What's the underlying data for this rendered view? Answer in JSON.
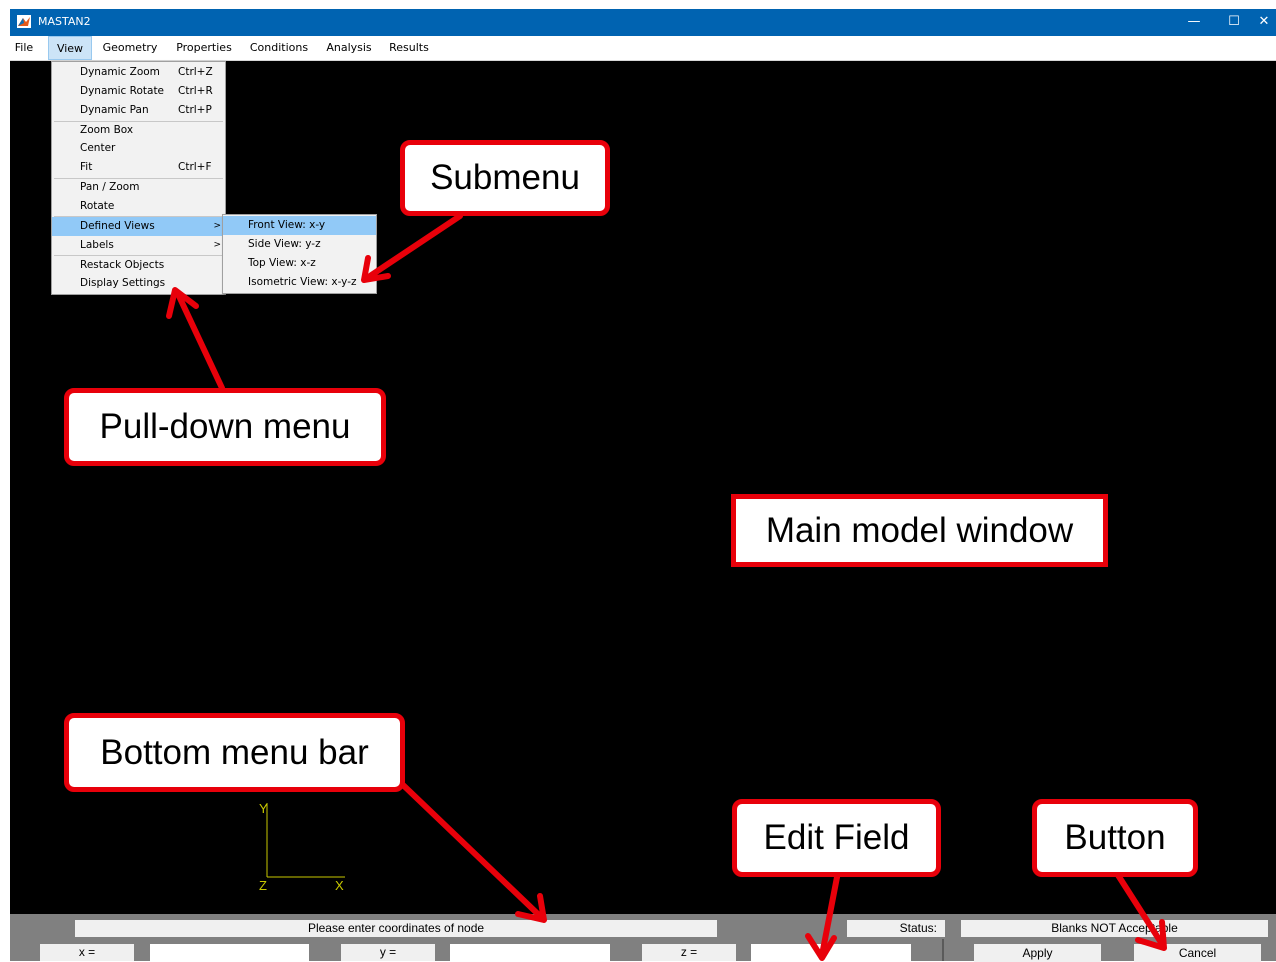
{
  "window": {
    "title": "MASTAN2",
    "minimize_glyph": "—",
    "maximize_glyph": "☐",
    "close_glyph": "✕"
  },
  "menubar": {
    "items": [
      "File",
      "View",
      "Geometry",
      "Properties",
      "Conditions",
      "Analysis",
      "Results"
    ]
  },
  "view_menu": {
    "items": [
      {
        "label": "Dynamic Zoom",
        "shortcut": "Ctrl+Z"
      },
      {
        "label": "Dynamic Rotate",
        "shortcut": "Ctrl+R"
      },
      {
        "label": "Dynamic Pan",
        "shortcut": "Ctrl+P"
      },
      {
        "label": "Zoom Box",
        "shortcut": ""
      },
      {
        "label": "Center",
        "shortcut": ""
      },
      {
        "label": "Fit",
        "shortcut": "Ctrl+F"
      },
      {
        "label": "Pan / Zoom",
        "shortcut": ""
      },
      {
        "label": "Rotate",
        "shortcut": ""
      },
      {
        "label": "Defined Views",
        "shortcut": ""
      },
      {
        "label": "Labels",
        "shortcut": ""
      },
      {
        "label": "Restack Objects",
        "shortcut": ""
      },
      {
        "label": "Display Settings",
        "shortcut": ""
      }
    ],
    "submenu_arrow": ">"
  },
  "defined_views_submenu": {
    "items": [
      "Front View: x-y",
      "Side View: y-z",
      "Top View: x-z",
      "Isometric View: x-y-z"
    ]
  },
  "callouts": {
    "submenu": "Submenu",
    "pulldown": "Pull-down menu",
    "main_window": "Main model window",
    "bottom_bar": "Bottom menu bar",
    "edit_field": "Edit Field",
    "button": "Button"
  },
  "axes": {
    "y_label": "Y",
    "z_label": "Z",
    "x_label": "X"
  },
  "bottom_bar": {
    "message": "Please enter coordinates of node",
    "status_label": "Status:",
    "status_value": "Blanks NOT Acceptable",
    "x_label": "x =",
    "y_label": "y =",
    "z_label": "z =",
    "x_value": "",
    "y_value": "",
    "z_value": "",
    "apply_label": "Apply",
    "cancel_label": "Cancel"
  },
  "colors": {
    "titlebar": "#0063b1",
    "callout_border": "#e8000a",
    "arrow": "#e8000a",
    "menu_highlight": "#91c9f7",
    "axis": "#c8c800"
  }
}
